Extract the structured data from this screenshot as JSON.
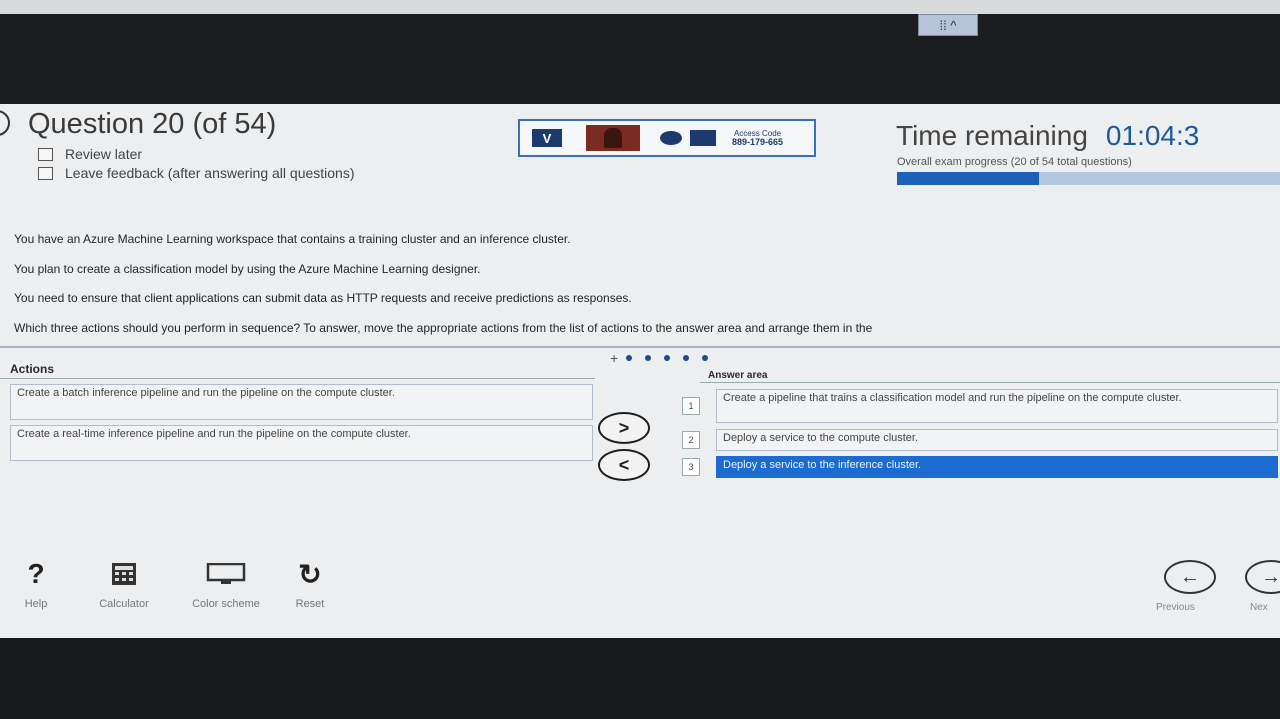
{
  "topbar": {
    "handle_label": "⁞⁞ ^"
  },
  "question": {
    "title": "Question 20 (of 54)",
    "review_later": "Review later",
    "leave_feedback": "Leave feedback (after answering all questions)"
  },
  "proctor": {
    "logo": "V",
    "access_label": "Access Code",
    "access_code": "889-179-665"
  },
  "timer": {
    "label": "Time remaining",
    "value": "01:04:3",
    "progress_text": "Overall exam progress (20 of 54 total questions)",
    "progress_fraction": 0.37
  },
  "body": {
    "paragraphs": [
      "You have an Azure Machine Learning workspace that contains a training cluster and an inference cluster.",
      "You plan to create a classification model by using the Azure Machine Learning designer.",
      "You need to ensure that client applications can submit data as HTTP requests and receive predictions as responses.",
      "Which three actions should you perform in sequence? To answer, move the appropriate actions from the list of actions to the answer area and arrange them in the"
    ]
  },
  "actions": {
    "label": "Actions",
    "items": [
      "Create a batch inference pipeline and run the pipeline on the compute cluster.",
      "Create a real-time inference pipeline and run the pipeline on the compute cluster."
    ]
  },
  "move": {
    "right": ">",
    "left": "<"
  },
  "answer": {
    "label": "Answer area",
    "items": [
      {
        "num": "1",
        "text": "Create a pipeline that trains a classification model and run the pipeline on the compute cluster."
      },
      {
        "num": "2",
        "text": "Deploy a service to the compute cluster."
      },
      {
        "num": "3",
        "text": "Deploy a service to the inference cluster."
      }
    ]
  },
  "toolbar": {
    "help": "Help",
    "calculator": "Calculator",
    "color_scheme": "Color scheme",
    "reset": "Reset",
    "previous": "Previous",
    "next": "Nex"
  }
}
